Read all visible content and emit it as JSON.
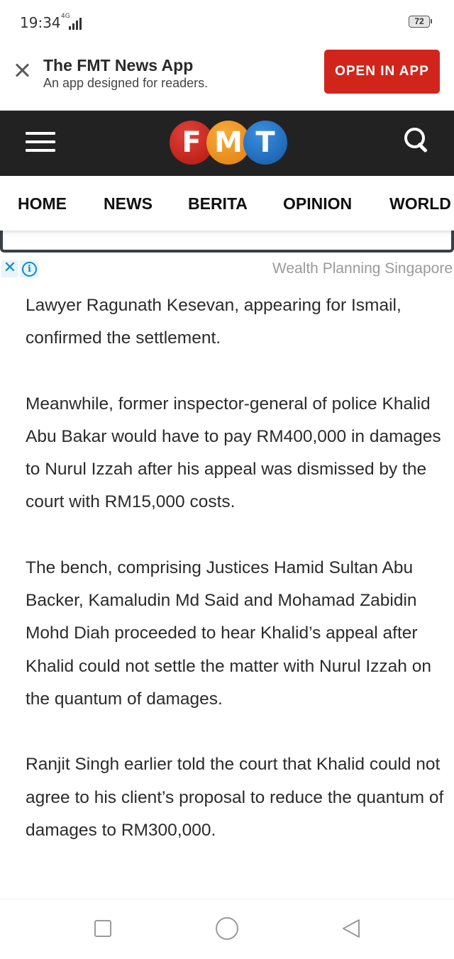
{
  "status_bar": {
    "time": "19:34",
    "network": "4G",
    "battery": "72"
  },
  "app_banner": {
    "title": "The FMT News App",
    "subtitle": "An app designed for readers.",
    "open_button": "OPEN IN APP",
    "button_color": "#d1251c"
  },
  "header": {
    "logo_letters": [
      "F",
      "M",
      "T"
    ],
    "logo_colors": [
      "#c8201b",
      "#f0901a",
      "#1a6fc0"
    ],
    "background": "#222222"
  },
  "nav": {
    "items": [
      "HOME",
      "NEWS",
      "BERITA",
      "OPINION",
      "WORLD"
    ]
  },
  "ad": {
    "close": "✕",
    "info": "i",
    "text": "Wealth Planning Singapore"
  },
  "article": {
    "paragraphs": [
      "Lawyer Ragunath Kesevan, appearing for Ismail, confirmed the settlement.",
      "Meanwhile, former inspector-general of police Khalid Abu Bakar would have to pay RM400,000 in damages to Nurul Izzah after his appeal was dismissed by the court with RM15,000 costs.",
      "The bench, comprising Justices Hamid Sultan Abu Backer, Kamaludin Md Said and Mohamad Zabidin Mohd Diah proceeded to hear Khalid’s appeal after Khalid could not settle the matter with Nurul Izzah on the quantum of damages.",
      "Ranjit Singh earlier told the court that Khalid could not agree to his client’s proposal to reduce the quantum of damages to RM300,000."
    ]
  },
  "system_nav": {
    "icons": [
      "recent-apps-icon",
      "home-icon",
      "back-icon"
    ]
  }
}
